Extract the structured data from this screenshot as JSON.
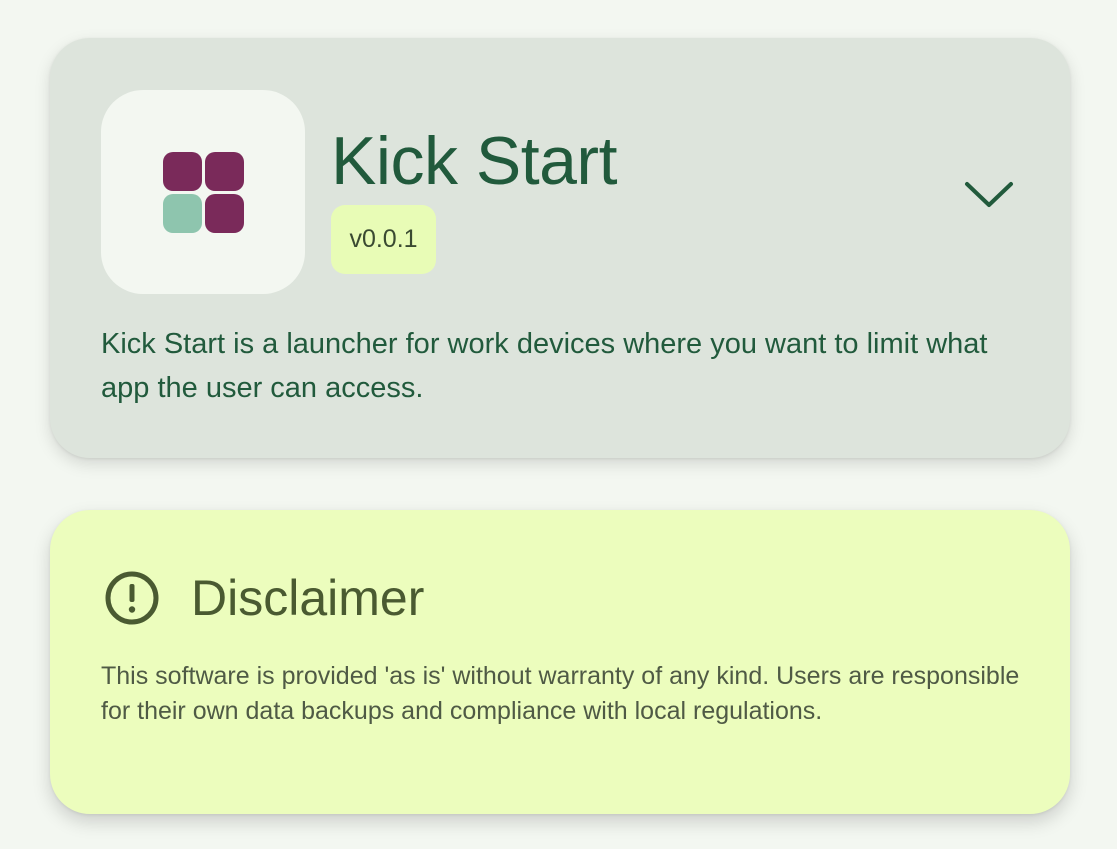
{
  "app_card": {
    "title": "Kick Start",
    "version": "v0.0.1",
    "description": "Kick Start is a launcher for work devices where you want to limit what app the user can access.",
    "expand_icon": "chevron-down-icon",
    "app_icon": "app-grid-icon"
  },
  "disclaimer": {
    "title": "Disclaimer",
    "icon": "alert-circle-icon",
    "text": "This software is provided 'as is' without warranty of any kind. Users are responsible for their own data backups and compliance with local regulations."
  },
  "colors": {
    "background": "#f3f7f1",
    "app_card": "#dde4dc",
    "disclaimer_card": "#ecfdbd",
    "primary_text": "#215a3c",
    "badge_background": "#e8fcb6",
    "icon_magenta": "#7a2a5a",
    "icon_teal": "#8ec5ae",
    "disclaimer_text": "#4a5a31"
  }
}
